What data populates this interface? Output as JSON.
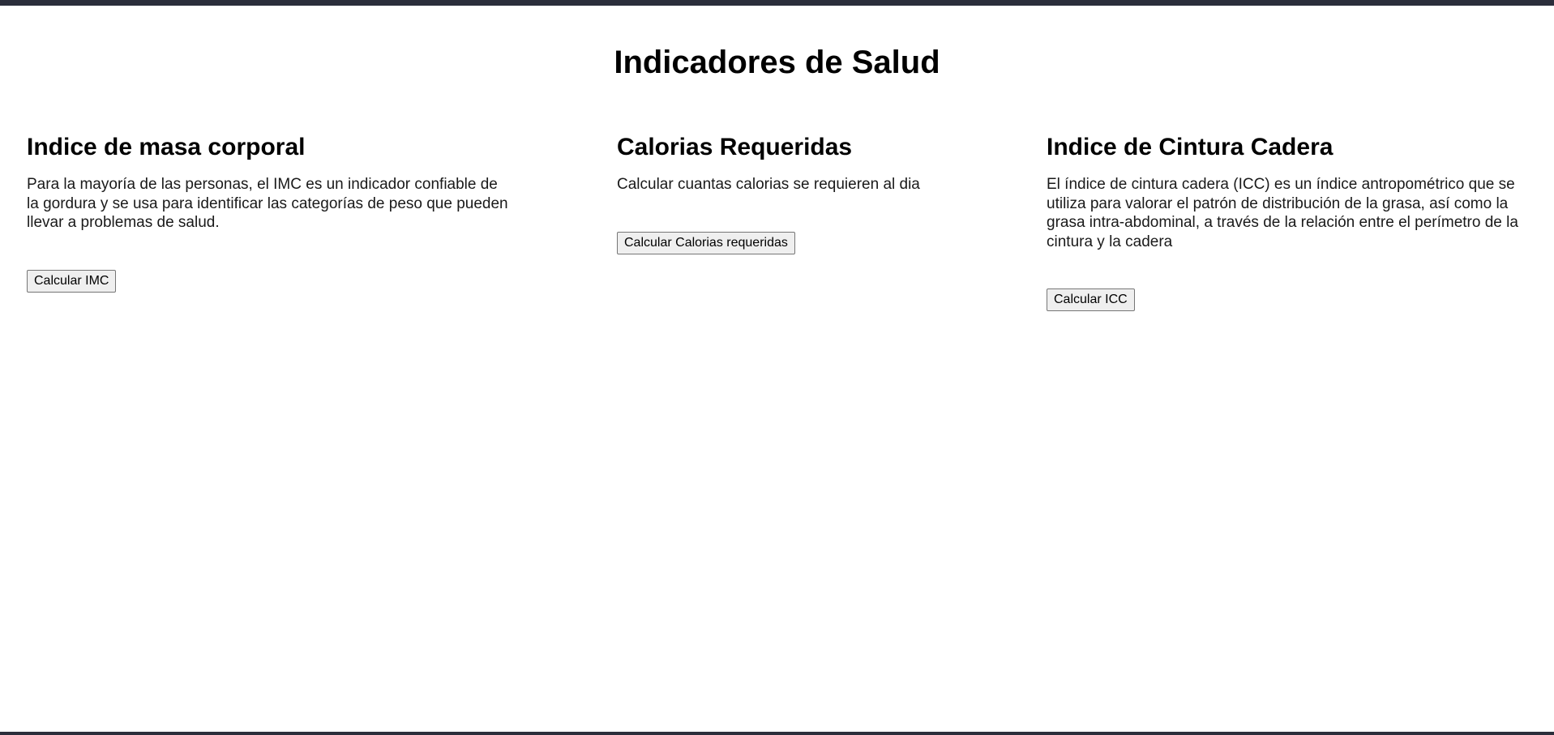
{
  "page": {
    "title": "Indicadores de Salud"
  },
  "cards": [
    {
      "title": "Indice de masa corporal",
      "description": "Para la mayoría de las personas, el IMC es un indicador confiable de la gordura y se usa para identificar las categorías de peso que pueden llevar a problemas de salud.",
      "button_label": "Calcular IMC"
    },
    {
      "title": "Calorias Requeridas",
      "description": "Calcular cuantas calorias se requieren al dia",
      "button_label": "Calcular Calorias requeridas"
    },
    {
      "title": "Indice de Cintura Cadera",
      "description": "El índice de cintura cadera (ICC) es un índice antropométrico que se utiliza para valorar el patrón de distribución de la grasa, así como la grasa intra-abdominal, a través de la relación entre el perímetro de la cintura y la cadera",
      "button_label": "Calcular ICC"
    }
  ],
  "colors": {
    "frame": "#2b2e3b",
    "background": "#ffffff",
    "text": "#1a1a1a",
    "button_bg": "#efefef",
    "button_border": "#767676"
  }
}
